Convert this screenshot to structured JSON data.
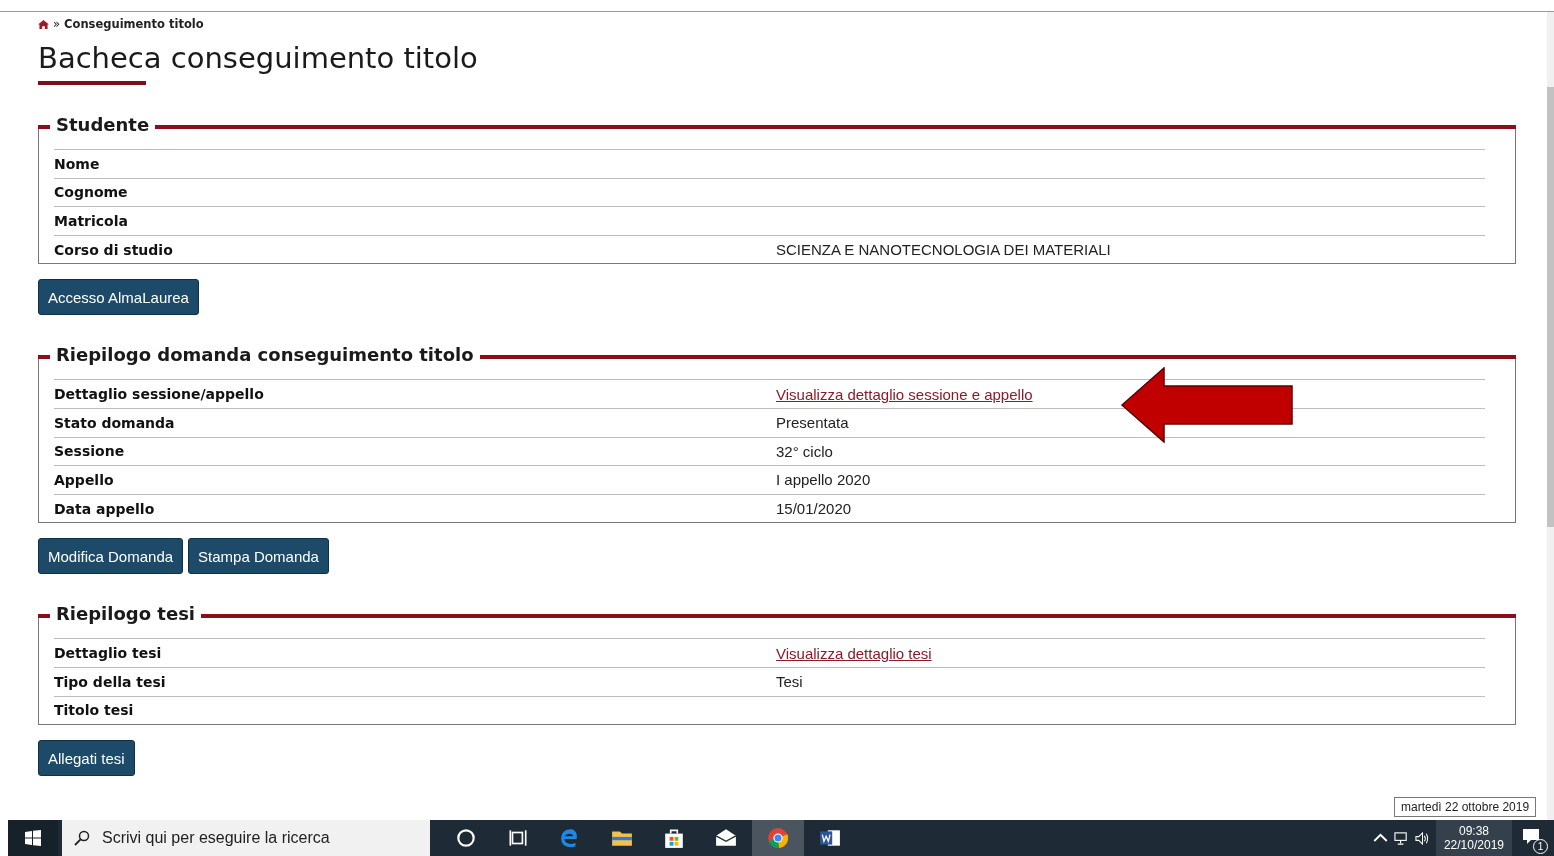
{
  "breadcrumb": {
    "separator": "»",
    "current": "Conseguimento titolo"
  },
  "page_title": "Bacheca conseguimento titolo",
  "sections": [
    {
      "title": "Studente",
      "rows": [
        {
          "label": "Nome"
        },
        {
          "label": "Cognome"
        },
        {
          "label": "Matricola"
        },
        {
          "label": "Corso di studio",
          "kind": "text",
          "value": "SCIENZA E NANOTECNOLOGIA DEI MATERIALI"
        }
      ],
      "buttons": [
        "Accesso AlmaLaurea"
      ]
    },
    {
      "title": "Riepilogo domanda conseguimento titolo",
      "rows": [
        {
          "label": "Dettaglio sessione/appello",
          "kind": "link",
          "value": "Visualizza dettaglio sessione e appello"
        },
        {
          "label": "Stato domanda",
          "kind": "text",
          "value": "Presentata"
        },
        {
          "label": "Sessione",
          "kind": "text",
          "value": "32° ciclo"
        },
        {
          "label": "Appello",
          "kind": "text",
          "value": "I appello 2020"
        },
        {
          "label": "Data appello",
          "kind": "text",
          "value": "15/01/2020"
        }
      ],
      "buttons": [
        "Modifica Domanda",
        "Stampa Domanda"
      ]
    },
    {
      "title": "Riepilogo tesi",
      "rows": [
        {
          "label": "Dettaglio tesi",
          "kind": "link",
          "value": "Visualizza dettaglio tesi"
        },
        {
          "label": "Tipo della tesi",
          "kind": "text",
          "value": "Tesi"
        },
        {
          "label": "Titolo tesi"
        }
      ],
      "buttons": [
        "Allegati tesi"
      ]
    }
  ],
  "tooltip": "martedì 22 ottobre 2019",
  "taskbar": {
    "search": {
      "placeholder": "Scrivi qui per eseguire la ricerca"
    },
    "time": "09:38",
    "date": "22/10/2019",
    "notification_count": "1"
  }
}
